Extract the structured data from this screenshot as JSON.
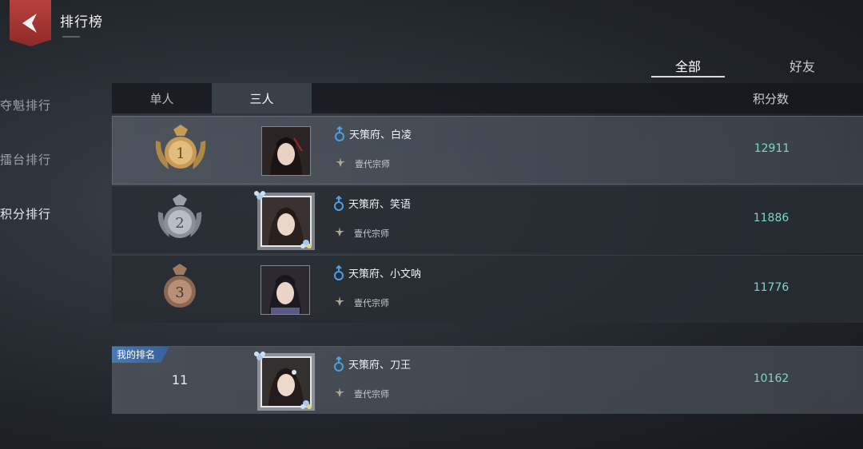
{
  "header": {
    "title": "排行榜"
  },
  "sidebar": {
    "items": [
      {
        "label": "夺魁排行"
      },
      {
        "label": "擂台排行"
      },
      {
        "label": "积分排行"
      }
    ]
  },
  "top_tabs": [
    {
      "label": "全部"
    },
    {
      "label": "好友"
    }
  ],
  "sub_tabs": [
    {
      "label": "单人"
    },
    {
      "label": "三人"
    }
  ],
  "columns": {
    "score": "积分数"
  },
  "rows": [
    {
      "rank": "1",
      "name": "天策府、白凌",
      "title": "壹代宗师",
      "score": "12911"
    },
    {
      "rank": "2",
      "name": "天策府、笑语",
      "title": "壹代宗师",
      "score": "11886"
    },
    {
      "rank": "3",
      "name": "天策府、小文呐",
      "title": "壹代宗师",
      "score": "11776"
    }
  ],
  "my_rank": {
    "badge": "我的排名",
    "rank": "11",
    "name": "天策府、刀王",
    "title": "壹代宗师",
    "score": "10162"
  },
  "colors": {
    "gold": "#c89a55",
    "silver": "#9aa0a8",
    "bronze": "#a07a60",
    "score": "#7fd4c8",
    "male": "#4aa0e8"
  }
}
